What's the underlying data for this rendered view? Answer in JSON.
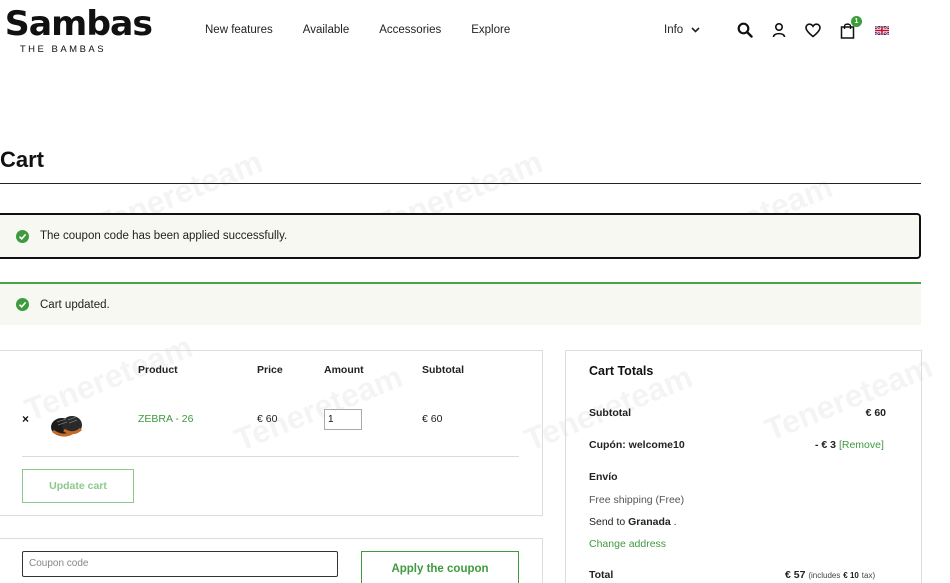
{
  "brand": {
    "logo_main": "Sambas",
    "logo_sub": "THE BAMBAS"
  },
  "nav": {
    "items": [
      {
        "label": "New features"
      },
      {
        "label": "Available"
      },
      {
        "label": "Accessories"
      },
      {
        "label": "Explore"
      }
    ],
    "info_label": "Info",
    "cart_count": "1",
    "icons": [
      "search-icon",
      "account-icon",
      "heart-icon",
      "cart-bag-icon",
      "uk-flag-icon"
    ]
  },
  "page": {
    "title": "Cart"
  },
  "notices": {
    "coupon_applied": "The coupon code has been applied successfully.",
    "cart_updated": "Cart updated."
  },
  "cart_table": {
    "headers": {
      "product": "Product",
      "price": "Price",
      "amount": "Amount",
      "subtotal": "Subtotal"
    },
    "rows": [
      {
        "remove": "×",
        "product": "ZEBRA - 26",
        "price": "€ 60",
        "quantity": "1",
        "subtotal": "€ 60"
      }
    ],
    "update_button": "Update cart"
  },
  "coupon": {
    "placeholder": "Coupon code",
    "apply_button": "Apply the coupon"
  },
  "totals": {
    "title": "Cart Totals",
    "subtotal_label": "Subtotal",
    "subtotal_value": "€ 60",
    "coupon_label": "Cupón: welcome10",
    "coupon_value": "- € 3",
    "coupon_remove": "[Remove]",
    "shipping_label": "Envío",
    "shipping_method": "Free shipping (Free)",
    "send_to_prefix": "Send to",
    "send_to_city": "Granada",
    "send_to_suffix": ".",
    "change_address": "Change address",
    "total_label": "Total",
    "total_value": "€ 57",
    "tax_prefix": "(includes",
    "tax_value": "€ 10",
    "tax_suffix": "tax)"
  },
  "watermark": "Tenereteam",
  "colors": {
    "accent_green": "#3f9a3f",
    "notice_bg": "#f7f8f1",
    "badge_green": "#3a9d3a"
  }
}
